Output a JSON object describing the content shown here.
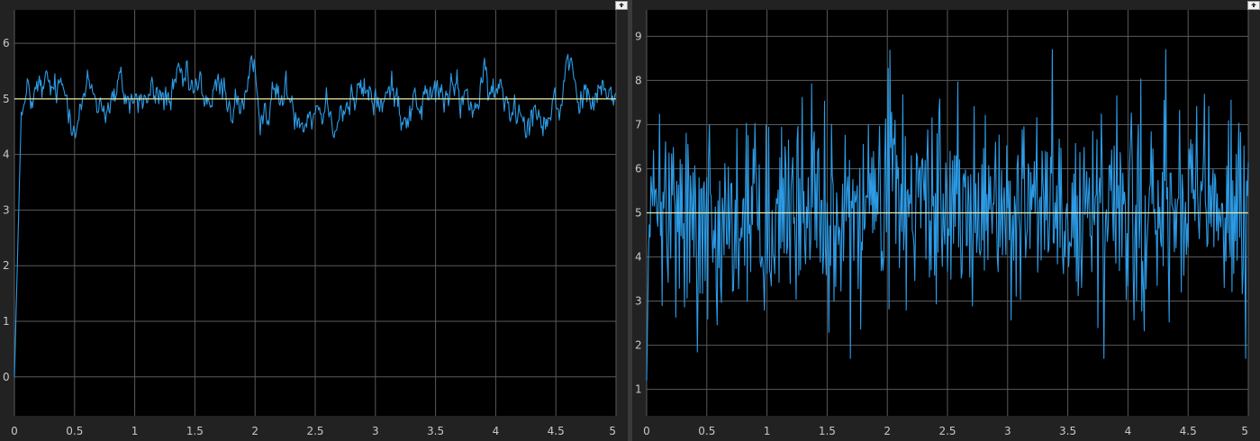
{
  "colors": {
    "signal": "#2c9be6",
    "reference": "#e8e8a6",
    "grid": "#5a5a5a",
    "axis_text": "#c8c8c8",
    "plot_background": "#000000"
  },
  "chart_data": [
    {
      "type": "line",
      "title": "",
      "xlabel": "",
      "ylabel": "",
      "xlim": [
        0,
        5
      ],
      "ylim": [
        -0.7,
        6.6
      ],
      "xticks": [
        "0",
        "0.5",
        "1",
        "1.5",
        "2",
        "2.5",
        "3",
        "3.5",
        "4",
        "4.5",
        "5"
      ],
      "yticks": [
        "0",
        "1",
        "2",
        "3",
        "4",
        "5",
        "6"
      ],
      "grid": true,
      "series": [
        {
          "kind": "noisy_signal",
          "style": "filtered",
          "start_value": 0,
          "rise_end_x": 0.06,
          "mean": 5.0,
          "amplitude": 0.35,
          "min": 4.3,
          "max": 5.8,
          "points": 700
        },
        {
          "kind": "reference",
          "value": 5.0
        }
      ]
    },
    {
      "type": "line",
      "title": "",
      "xlabel": "",
      "ylabel": "",
      "xlim": [
        0,
        5
      ],
      "ylim": [
        0.4,
        9.6
      ],
      "xticks": [
        "0",
        "0.5",
        "1",
        "1.5",
        "2",
        "2.5",
        "3",
        "3.5",
        "4",
        "4.5",
        "5"
      ],
      "yticks": [
        "1",
        "2",
        "3",
        "4",
        "5",
        "6",
        "7",
        "8",
        "9"
      ],
      "grid": true,
      "series": [
        {
          "kind": "noisy_signal",
          "style": "raw",
          "start_value": 1.2,
          "rise_end_x": 0.02,
          "mean": 5.0,
          "amplitude": 1.1,
          "min": 1.7,
          "max": 8.7,
          "points": 700
        },
        {
          "kind": "reference",
          "value": 5.0
        }
      ]
    }
  ]
}
